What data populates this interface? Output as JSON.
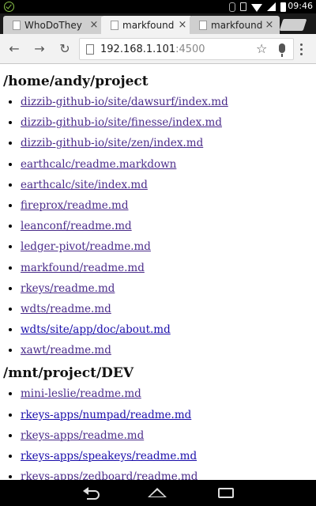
{
  "status_bar": {
    "time": "09:46"
  },
  "tabs": [
    {
      "title": "WhoDoThey",
      "active": false
    },
    {
      "title": "markfound",
      "active": true
    },
    {
      "title": "markfound",
      "active": false
    }
  ],
  "tab_close_glyph": "×",
  "toolbar": {
    "url_host": "192.168.1.101",
    "url_port": ":4500"
  },
  "sections": [
    {
      "heading": "/home/andy/project",
      "links": [
        {
          "text": "dizzib-github-io/site/dawsurf/index.md",
          "visited": true
        },
        {
          "text": "dizzib-github-io/site/finesse/index.md",
          "visited": true
        },
        {
          "text": "dizzib-github-io/site/zen/index.md",
          "visited": true
        },
        {
          "text": "earthcalc/readme.markdown",
          "visited": true
        },
        {
          "text": "earthcalc/site/index.md",
          "visited": true
        },
        {
          "text": "fireprox/readme.md",
          "visited": true
        },
        {
          "text": "leanconf/readme.md",
          "visited": true
        },
        {
          "text": "ledger-pivot/readme.md",
          "visited": true
        },
        {
          "text": "markfound/readme.md",
          "visited": true
        },
        {
          "text": "rkeys/readme.md",
          "visited": true
        },
        {
          "text": "wdts/readme.md",
          "visited": true
        },
        {
          "text": "wdts/site/app/doc/about.md",
          "visited": false
        },
        {
          "text": "xawt/readme.md",
          "visited": true
        }
      ]
    },
    {
      "heading": "/mnt/project/DEV",
      "links": [
        {
          "text": "mini-leslie/readme.md",
          "visited": true
        },
        {
          "text": "rkeys-apps/numpad/readme.md",
          "visited": false
        },
        {
          "text": "rkeys-apps/readme.md",
          "visited": true
        },
        {
          "text": "rkeys-apps/speakeys/readme.md",
          "visited": false
        },
        {
          "text": "rkeys-apps/zedboard/readme.md",
          "visited": true
        }
      ]
    }
  ]
}
